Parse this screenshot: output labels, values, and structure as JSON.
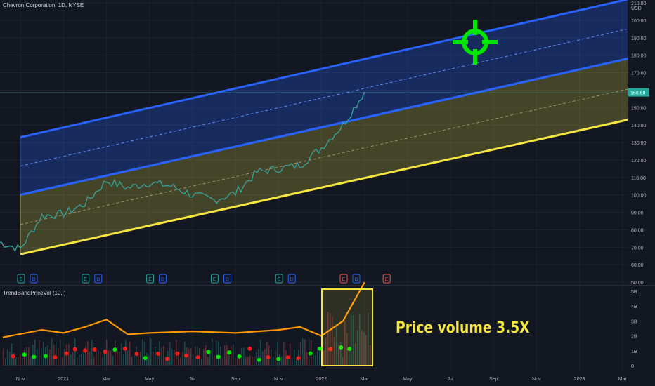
{
  "header": {
    "title": "Chevron Corporation, 1D, NYSE"
  },
  "indicator": {
    "name": "TrendBandPriceVol (10, )"
  },
  "annotation": {
    "text": "Price volume 3.5X"
  },
  "colors": {
    "background": "#131722",
    "upper_band": "#2962ff",
    "lower_band": "#f5e642",
    "target": "#00e600",
    "price": "#26a69a",
    "price_down": "#ef5350",
    "volume_line": "#ff9800",
    "highlight_box": "#f5e642"
  },
  "chart_data": [
    {
      "type": "line",
      "title": "Chevron Corporation, 1D, NYSE",
      "y_unit": "USD",
      "x_tick_labels": [
        "Nov",
        "2021",
        "Mar",
        "May",
        "Jul",
        "Sep",
        "Nov",
        "2022",
        "Mar",
        "May",
        "Jul",
        "Sep",
        "Nov",
        "2023",
        "Mar"
      ],
      "y_tick_labels": [
        "210.00",
        "200.00",
        "190.00",
        "180.00",
        "170.00",
        "160.00",
        "150.00",
        "140.00",
        "130.00",
        "120.00",
        "110.00",
        "100.00",
        "90.00",
        "80.00",
        "70.00",
        "60.00",
        "50.00"
      ],
      "ylim": [
        50,
        210
      ],
      "last_price_label": "158.69",
      "series": [
        {
          "x": [
            "Oct 2020",
            "Nov 2020",
            "Dec 2020",
            "2021",
            "Feb 2021",
            "Mar 2021",
            "Apr 2021",
            "May 2021",
            "Jun 2021",
            "Jul 2021",
            "Aug 2021",
            "Sep 2021",
            "Oct 2021",
            "Nov 2021",
            "Dec 2021",
            "2022",
            "Feb 2022",
            "Mar 2022"
          ],
          "values": [
            73,
            69,
            88,
            89,
            95,
            108,
            104,
            107,
            105,
            100,
            97,
            101,
            113,
            115,
            117,
            127,
            140,
            159
          ]
        }
      ],
      "channels": [
        {
          "name_hint": "upper",
          "start": {
            "x": "Nov 2020",
            "upper": 133,
            "lower": 100
          },
          "end": {
            "x": "Mar 2023",
            "upper": 212,
            "lower": 178
          }
        },
        {
          "name_hint": "lower",
          "start": {
            "x": "Nov 2020",
            "upper": 100,
            "lower": 66
          },
          "end": {
            "x": "Mar 2023",
            "upper": 178,
            "lower": 143
          }
        }
      ],
      "event_markers": [
        {
          "x": "Nov 2020",
          "labels": [
            "E",
            "D"
          ]
        },
        {
          "x": "Feb 2021",
          "labels": [
            "E",
            "D"
          ]
        },
        {
          "x": "May 2021",
          "labels": [
            "E",
            "D"
          ]
        },
        {
          "x": "Aug 2021",
          "labels": [
            "E",
            "D"
          ]
        },
        {
          "x": "Nov 2021",
          "labels": [
            "E",
            "D"
          ]
        },
        {
          "x": "Feb 2022",
          "labels": [
            "E",
            "D"
          ]
        },
        {
          "x": "Apr 2022",
          "labels": [
            "E"
          ]
        }
      ]
    },
    {
      "type": "line",
      "title": "TrendBandPriceVol (10, )",
      "y_tick_labels": [
        "5B",
        "4B",
        "3B",
        "2B",
        "1B",
        "0"
      ],
      "ylim": [
        0,
        5
      ],
      "series": [
        {
          "x": [
            "Oct 2020",
            "Dec 2020",
            "2021",
            "Feb 2021",
            "Mar 2021",
            "Apr 2021",
            "May 2021",
            "Jul 2021",
            "Sep 2021",
            "Nov 2021",
            "Dec 2021",
            "2022",
            "Feb 2022",
            "Mar 2022"
          ],
          "values": [
            1.9,
            2.4,
            2.2,
            2.6,
            3.1,
            2.1,
            2.2,
            2.3,
            2.2,
            2.4,
            2.6,
            2.0,
            3.0,
            5.6
          ]
        }
      ]
    }
  ]
}
